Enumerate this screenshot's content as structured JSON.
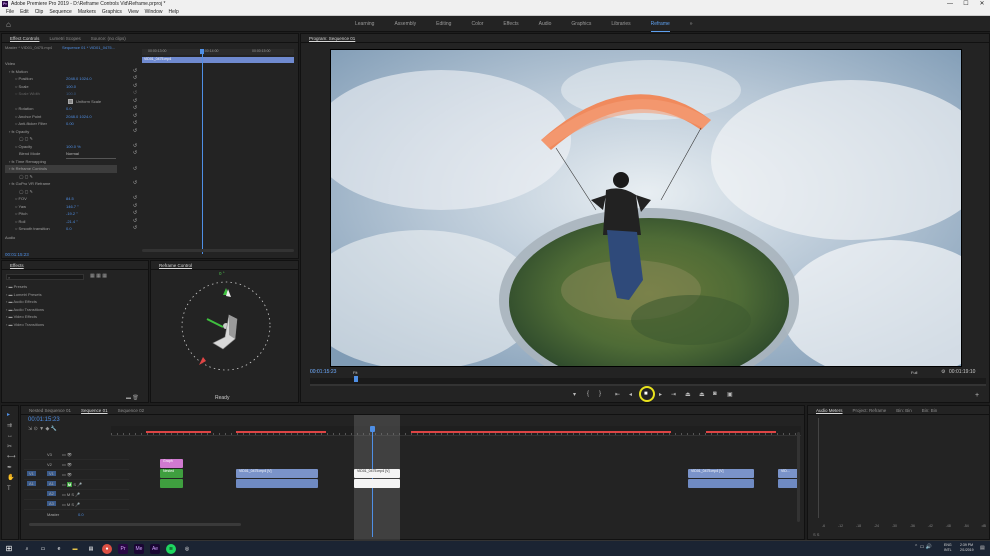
{
  "app": {
    "title": "Adobe Premiere Pro 2019 - D:\\Reframe Controls Vid\\Reframe.prproj *",
    "logo_text": "Pr",
    "window_buttons": [
      "—",
      "☐",
      "✕"
    ]
  },
  "menu": [
    "File",
    "Edit",
    "Clip",
    "Sequence",
    "Markers",
    "Graphics",
    "View",
    "Window",
    "Help"
  ],
  "workspaces": {
    "items": [
      "Learning",
      "Assembly",
      "Editing",
      "Color",
      "Effects",
      "Audio",
      "Graphics",
      "Libraries",
      "Reframe"
    ],
    "active": "Reframe",
    "more": "»"
  },
  "effect_controls": {
    "tabs": [
      "Effect Controls",
      "Lumetri Scopes",
      "Source: (no clips)"
    ],
    "master_label": "Master * VID01_0475.mp4",
    "sequence_label": "Sequence 01 * VID01_0475...",
    "clip_name": "VID01_0475.mp4",
    "ruler_times": [
      "00:00:13:00",
      "00:00:14:00",
      "00:00:15:00"
    ],
    "section_video": "Video",
    "motion": {
      "label": "Motion",
      "rows": [
        {
          "key": "Position",
          "value": "2048.0   1024.0"
        },
        {
          "key": "Scale",
          "value": "100.0"
        },
        {
          "key": "Scale Width",
          "value": "100.0"
        },
        {
          "key": "Uniform Scale",
          "value": ""
        },
        {
          "key": "Rotation",
          "value": "0.0"
        },
        {
          "key": "Anchor Point",
          "value": "2048.0   1024.0"
        },
        {
          "key": "Anti-flicker Filter",
          "value": "0.00"
        }
      ]
    },
    "opacity": {
      "label": "Opacity",
      "rows": [
        {
          "key": "Opacity",
          "value": "100.0 %"
        },
        {
          "key": "Blend Mode",
          "value": "Normal"
        }
      ]
    },
    "time_remapping": "Time Remapping",
    "reframe_controls": "Reframe Controls",
    "gofx": {
      "label": "GoPro VR Reframe",
      "rows": [
        {
          "key": "FOV",
          "value": "84.5"
        },
        {
          "key": "Yaw",
          "value": "146.7 °"
        },
        {
          "key": "Pitch",
          "value": "-19.2 °"
        },
        {
          "key": "Roll",
          "value": "-21.4 °"
        },
        {
          "key": "Smooth transition",
          "value": "0.0"
        }
      ]
    },
    "footer_label": "Audio",
    "timecode": "00:01:15:23"
  },
  "effects_panel": {
    "tab": "Effects",
    "search_placeholder": "",
    "items": [
      "Presets",
      "Lumetri Presets",
      "Audio Effects",
      "Audio Transitions",
      "Video Effects",
      "Video Transitions"
    ]
  },
  "reframe_panel": {
    "tab": "Reframe Control",
    "angle": "0 °",
    "status": "Ready"
  },
  "program_monitor": {
    "tab": "Program: Sequence 01",
    "timecode": "00:01:15:23",
    "fit": "Fit",
    "quality": "Full",
    "duration": "00:01:19:10"
  },
  "project_tabs": {
    "items": [
      "Nested Sequence 01",
      "Sequence 01",
      "Sequence 02"
    ],
    "active": "Sequence 01"
  },
  "timeline": {
    "timecode": "00:01:15:23",
    "video_tracks": [
      "V3",
      "V2",
      "V1"
    ],
    "audio_tracks": [
      "A1",
      "A2",
      "A3"
    ],
    "master": "Master",
    "master_value": "0.0",
    "clips": [
      {
        "name": "Graph",
        "kind": "pink"
      },
      {
        "name": "Nested",
        "kind": "green"
      },
      {
        "name": "VID01_0475.mp4 [V]",
        "kind": "video"
      },
      {
        "name": "VID01_0475.mp4 [V]",
        "kind": "video2"
      },
      {
        "name": "VID01_0475.mp4 [V]",
        "kind": "video3"
      },
      {
        "name": "VID...",
        "kind": "video4"
      }
    ]
  },
  "audio_meters": {
    "tabs": [
      "Audio Meters",
      "Project: Reframe",
      "Bin: Bin",
      "Bin: Bin"
    ],
    "scale": [
      "-6",
      "-12",
      "-18",
      "-24",
      "-30",
      "-36",
      "-42",
      "-48",
      "-54",
      "dB"
    ],
    "solo": "S S"
  },
  "taskbar": {
    "lang": "ENG\nINTL",
    "time": "2:39 PM\n2/1/2019"
  },
  "colors": {
    "accent": "#4f8fe5",
    "playhead": "#4f8fe5",
    "highlight_ring": "#e8e21d"
  }
}
